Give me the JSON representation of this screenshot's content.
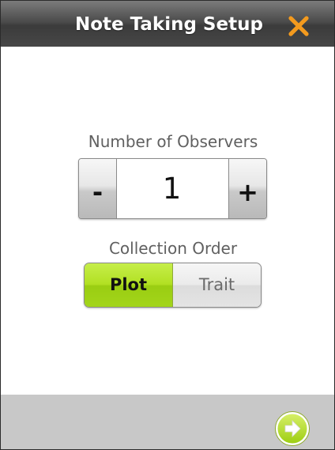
{
  "window": {
    "title": "Note Taking Setup"
  },
  "observers": {
    "label": "Number of Observers",
    "minus_label": "-",
    "plus_label": "+",
    "value": "1"
  },
  "collection_order": {
    "label": "Collection Order",
    "options": [
      {
        "label": "Plot",
        "selected": true
      },
      {
        "label": "Trait",
        "selected": false
      }
    ]
  },
  "icons": {
    "close": "close-x-icon",
    "next": "arrow-right-circle-icon"
  },
  "colors": {
    "titlebar": "#474747",
    "close_x": "#f39a1e",
    "selected_green": "#a8d81c",
    "footer": "#c8c8c8",
    "next_circle": "#b5dc2a"
  }
}
